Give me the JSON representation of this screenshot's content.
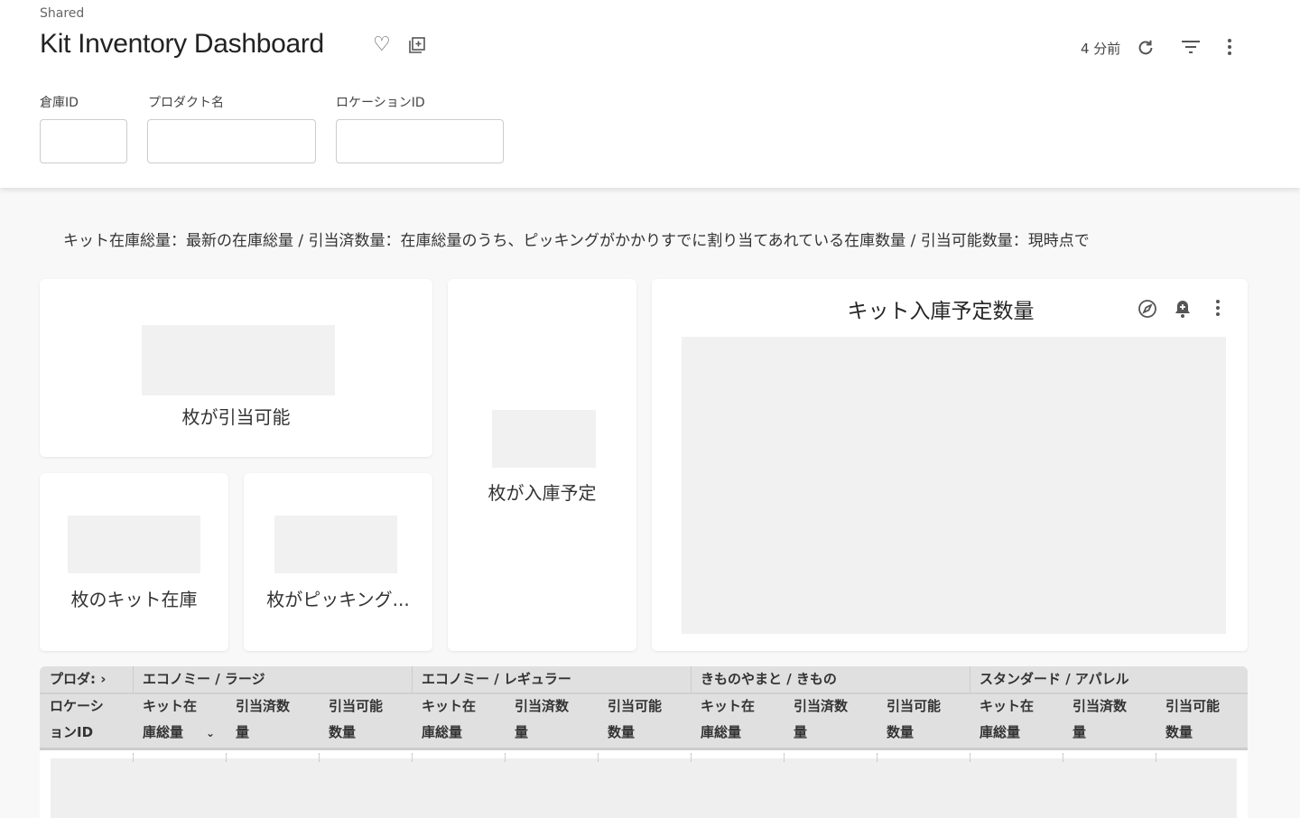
{
  "header": {
    "breadcrumb": "Shared",
    "title": "Kit Inventory Dashboard",
    "updated": "4 分前",
    "icons": [
      "heart-icon",
      "add-to-board-icon",
      "refresh-icon",
      "filter-icon",
      "more-vert-icon"
    ]
  },
  "filters": [
    {
      "label": "倉庫ID",
      "value": ""
    },
    {
      "label": "プロダクト名",
      "value": ""
    },
    {
      "label": "ロケーションID",
      "value": ""
    }
  ],
  "description": "キット在庫総量：最新の在庫総量 / 引当済数量：在庫総量のうち、ピッキングがかかりすでに割り当てあれている在庫数量 / 引当可能数量：現時点で",
  "tiles": {
    "available": "枚が引当可能",
    "incoming": "枚が入庫予定",
    "stock": "枚のキット在庫",
    "picking": "枚がピッキング..."
  },
  "chart": {
    "title": "キット入庫予定数量",
    "icons": [
      "explore-icon",
      "alert-bell-icon",
      "more-vert-icon"
    ]
  },
  "table": {
    "pivot_label": "プロダ: ›",
    "groups": [
      "エコノミー / ラージ",
      "エコノミー / レギュラー",
      "きものやまと / きもの",
      "スタンダード / アパレル"
    ],
    "row_header": [
      "ロケーシ",
      "ョンID"
    ],
    "columns": [
      [
        "キット在",
        "庫総量"
      ],
      [
        "引当済数",
        "量"
      ],
      [
        "引当可能",
        "数量"
      ]
    ],
    "sort_icon": "chevron-down-icon"
  }
}
